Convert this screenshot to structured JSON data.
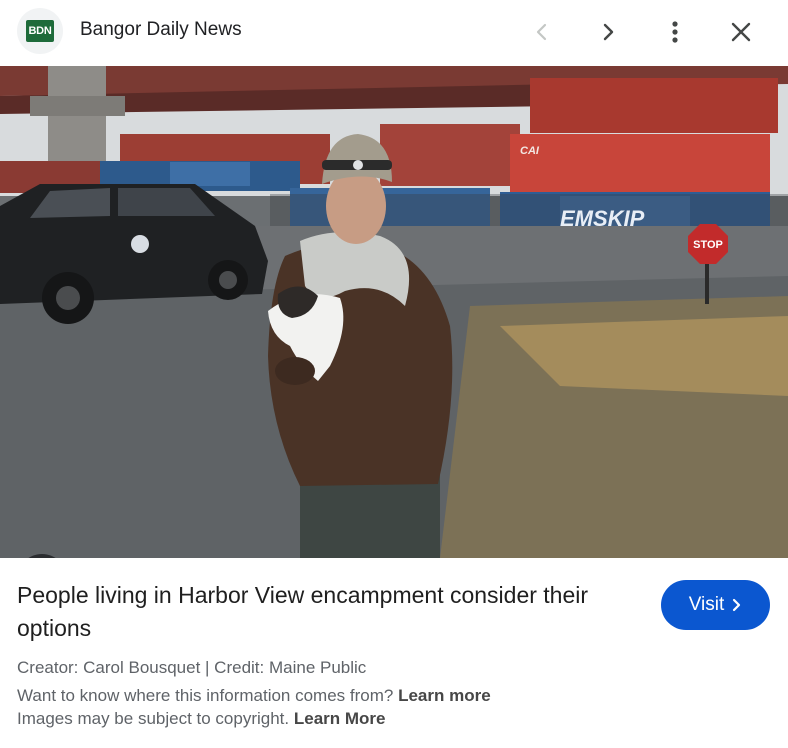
{
  "header": {
    "logo_text": "BDN",
    "source_name": "Bangor Daily News",
    "icons": {
      "back": "chevron-left-icon",
      "forward": "chevron-right-icon",
      "more": "more-vert-icon",
      "close": "close-icon"
    }
  },
  "image": {
    "signs": {
      "stop": "STOP",
      "container_brand": "EMSKIP",
      "container_code": "CAI"
    },
    "lens_icon": "google-lens-icon"
  },
  "details": {
    "title": "People living in Harbor View encampment consider their options",
    "visit_label": "Visit",
    "credit_line": "Creator: Carol Bousquet | Credit: Maine Public",
    "info_text": "Want to know where this information comes from?",
    "info_link": "Learn more",
    "copyright_text": "Images may be subject to copyright.",
    "copyright_link": "Learn More"
  },
  "colors": {
    "accent": "#0b57d0",
    "logo_green": "#1e6b3a",
    "secondary_text": "#5f6368"
  }
}
